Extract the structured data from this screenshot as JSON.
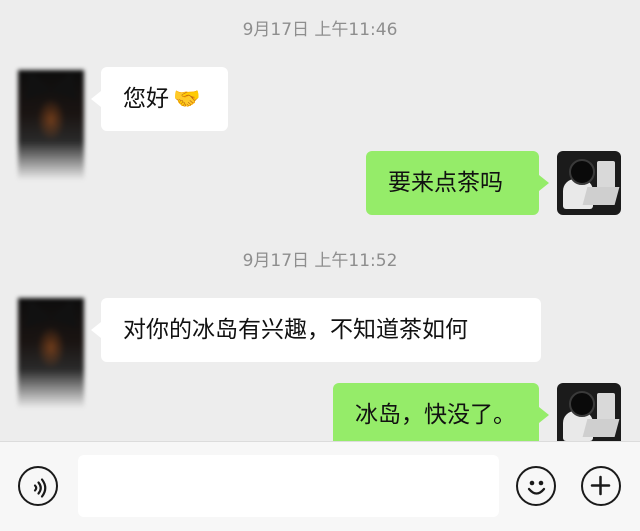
{
  "messages": {
    "timestamp_1": "9月17日 上午11:46",
    "msg_1_text": "您好",
    "msg_1_emoji": "🤝",
    "msg_2_text": "要来点茶吗",
    "timestamp_2": "9月17日 上午11:52",
    "msg_3_text": "对你的冰岛有兴趣，不知道茶如何",
    "msg_4_text": "冰岛，快没了。"
  },
  "input_bar": {
    "text_value": "",
    "icons": [
      "voice-icon",
      "emoji-icon",
      "plus-icon"
    ]
  },
  "colors": {
    "background": "#ededed",
    "bubble_sent": "#95ec69",
    "bubble_received": "#ffffff"
  }
}
